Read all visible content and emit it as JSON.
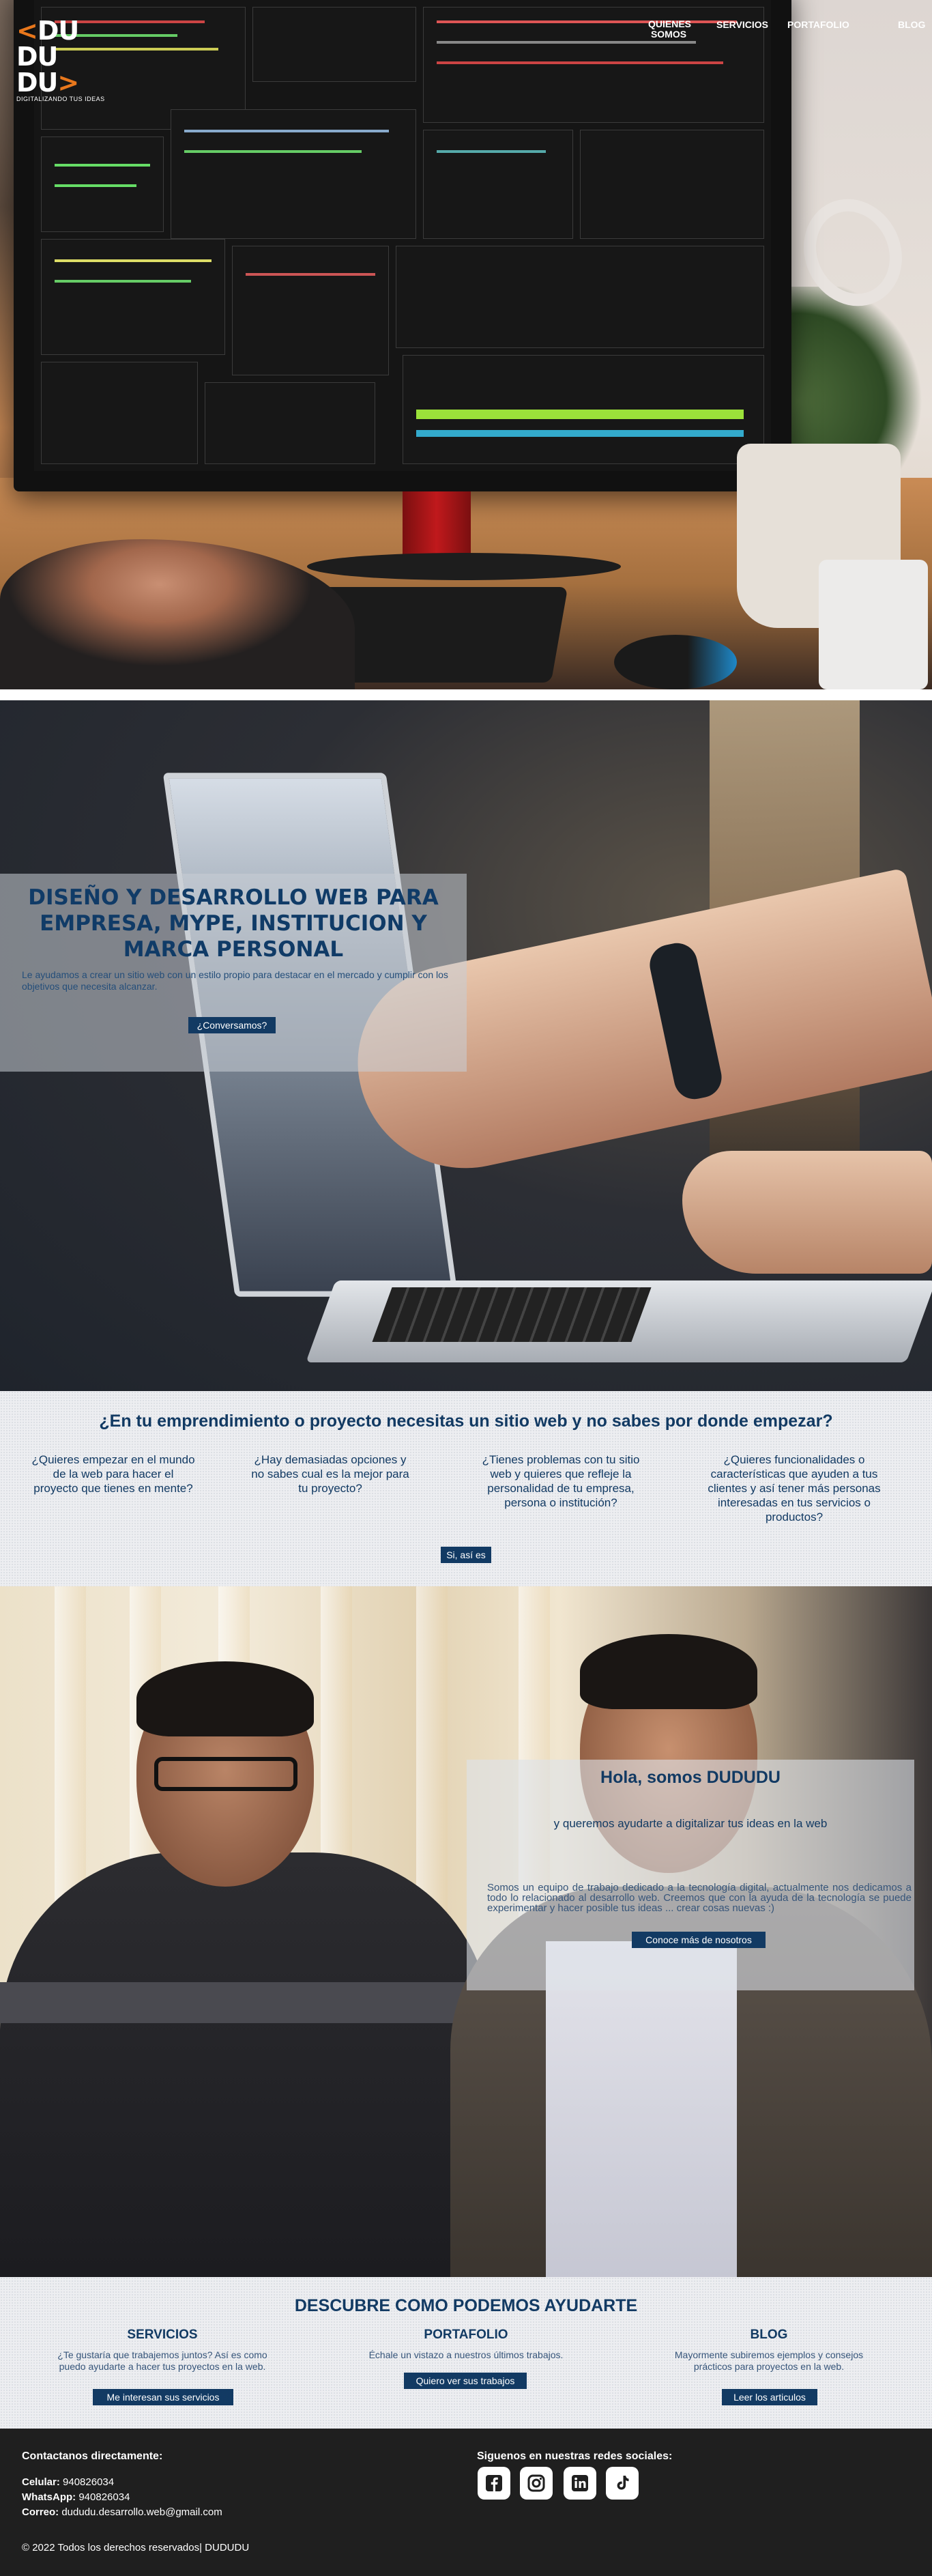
{
  "nav": {
    "logo_rows": [
      "DU",
      "DU",
      "DU"
    ],
    "logo_tagline": "DIGITALIZANDO TUS IDEAS",
    "links": [
      "QUIENES SOMOS",
      "SERVICIOS",
      "PORTAFOLIO",
      "BLOG"
    ]
  },
  "hero": {
    "title": "DISEÑO Y DESARROLLO WEB PARA EMPRESA, MYPE, INSTITUCION Y MARCA PERSONAL",
    "subtitle": "Le ayudamos a crear un sitio web con un estilo propio para destacar en el mercado y cumplir con los objetivos que necesita alcanzar.",
    "cta": "¿Conversamos?"
  },
  "questions": {
    "title": "¿En tu emprendimiento o proyecto necesitas un sitio web y no sabes por donde empezar?",
    "items": [
      "¿Quieres empezar en el mundo de la web para hacer el proyecto que tienes en mente?",
      "¿Hay demasiadas opciones y no sabes cual es la mejor para tu proyecto?",
      "¿Tienes problemas con tu sitio web y quieres que refleje la personalidad de tu empresa, persona o institución?",
      "¿Quieres funcionalidades o características que ayuden a tus clientes y así tener más personas interesadas en tus servicios o productos?"
    ],
    "cta": "Si, así es"
  },
  "team": {
    "title": "Hola, somos DUDUDU",
    "subtitle": "y queremos ayudarte a digitalizar tus ideas en la web",
    "text": "Somos un equipo de trabajo dedicado a la tecnología digital, actualmente nos dedicamos a todo lo relacionado al desarrollo web. Creemos que con la ayuda de la tecnología se puede experimentar y hacer posible tus ideas ... crear cosas nuevas :)",
    "cta": "Conoce más de nosotros"
  },
  "services": {
    "title": "DESCUBRE COMO PODEMOS AYUDARTE",
    "columns": [
      {
        "heading": "SERVICIOS",
        "text": "¿Te gustaría que trabajemos juntos? Así es como puedo ayudarte a hacer tus proyectos en la web.",
        "cta": "Me interesan sus servicios"
      },
      {
        "heading": "PORTAFOLIO",
        "text": "Échale un vistazo a nuestros últimos trabajos.",
        "cta": "Quiero ver sus trabajos"
      },
      {
        "heading": "BLOG",
        "text": "Mayormente subiremos ejemplos y consejos prácticos para proyectos en la web.",
        "cta": "Leer los articulos"
      }
    ]
  },
  "footer": {
    "contact_heading": "Contactanos directamente:",
    "phone_label": "Celular:",
    "phone": "940826034",
    "whatsapp_label": "WhatsApp:",
    "whatsapp": "940826034",
    "email_label": "Correo:",
    "email": "dududu.desarrollo.web@gmail.com",
    "social_heading": "Siguenos en nuestras redes sociales:",
    "social_icons": [
      "facebook-icon",
      "instagram-icon",
      "linkedin-icon",
      "tiktok-icon"
    ],
    "copyright": "© 2022 Todos los derechos reservados| DUDUDU"
  },
  "colors": {
    "brand_navy": "#123a63",
    "brand_orange": "#e8771c",
    "footer_bg": "#1f1f1f"
  }
}
